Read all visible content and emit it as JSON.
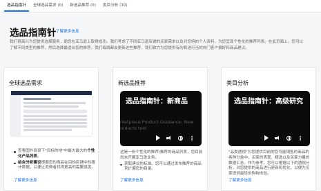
{
  "tabs": [
    {
      "label": "选品指南针",
      "active": true
    },
    {
      "label": "全球选品需求 (0)",
      "active": false
    },
    {
      "label": "新选品推荐 (0)",
      "active": false
    },
    {
      "label": "类目分析 (30)",
      "active": false
    }
  ],
  "page": {
    "title": "选品指南针",
    "learn_more": "了解更多信息",
    "intro": "我们很高兴为您提供选择服务，助您在亚马逊上取得成功。我们考虑了不同亚马逊店铺的买家需求以及对您特的个人资料，为您呈现个性化的推荐列表。在此页面上，您可以了解不同类型的推荐，然后选择最适合您的推荐。我们每周都会更新这些推荐，我们致力为您提供有的和进行当的热门客户偏好和商品建议。"
  },
  "cards": [
    {
      "title": "全球选品需求",
      "bullets": [
        {
          "prefix": "查看国外目录下\"目标的地\"中最大最大的",
          "bold": "个性化产品列表",
          "suffix": "。"
        },
        {
          "prefix": "",
          "bold": "结合分析建议",
          "suffix": "根据您的商品在目标店铺中的搜计数据，以便让消费者找得更高的需要强度。"
        }
      ],
      "link": "了解更多信息"
    },
    {
      "title": "新选品推荐",
      "video_text": "选品指南针：新商品",
      "video_sub": "arketplace Product Guidance: New products tool",
      "desc": "这是一份个性化的推荐/推荐的商品列表，您目前尚未开展亚马逊业务。",
      "bullets": [
        "获取建议的标准。您可以通过发布推荐的商品来扩展您的目录。"
      ],
      "link": "了解更多信息"
    },
    {
      "title": "类目分析",
      "video_text": "选品指南针：高级研究",
      "desc": "\"品类透视\"为您提供目前的您可能销售的商品的各种分类中，买家的表现、精选以及买家力量的数据汇总。作为参考，您可以根据以下的透视分析，对您提供的商品进行更新和优化，以便为买家提供最佳的购物体验。",
      "link": "了解更多信息"
    }
  ],
  "colors": {
    "accent": "#1a73e8",
    "video_bg": "#0b0b0b",
    "header_dark": "#1f2a44"
  },
  "icons": [
    "play-icon",
    "volume-icon",
    "language-icon",
    "more-options-icon"
  ]
}
